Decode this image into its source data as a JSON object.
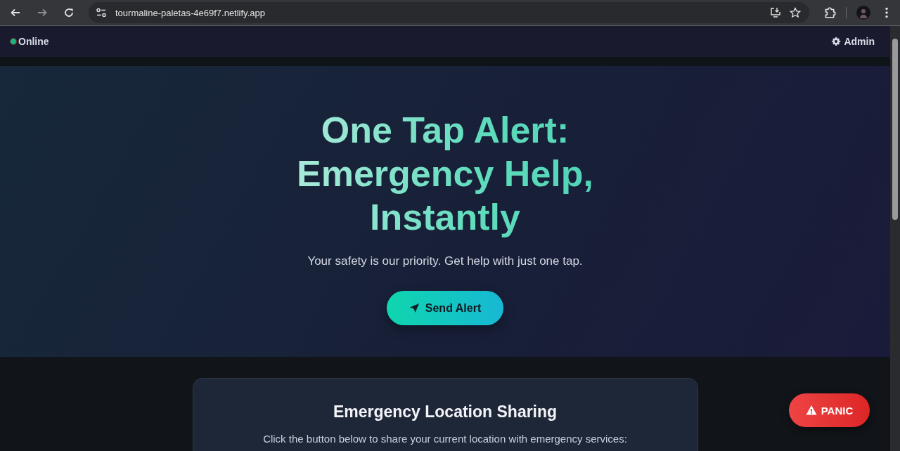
{
  "browser": {
    "url": "tourmaline-paletas-4e69f7.netlify.app"
  },
  "nav": {
    "status": {
      "label": "Online",
      "online": true
    },
    "admin": "Admin"
  },
  "hero": {
    "title": "One Tap Alert: Emergency Help, Instantly",
    "subtitle": "Your safety is our priority. Get help with just one tap.",
    "button": "Send Alert"
  },
  "card": {
    "title": "Emergency Location Sharing",
    "text": "Click the button below to share your current location with emergency services:"
  },
  "panic_button": "PANIC"
}
